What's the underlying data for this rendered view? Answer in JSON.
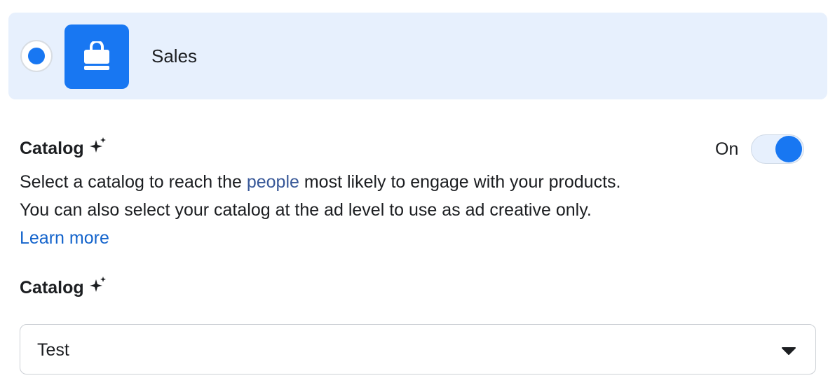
{
  "objective": {
    "label": "Sales",
    "selected": true,
    "icon": "shopping-bag-icon",
    "accent_color": "#1877f2",
    "card_background": "#e7f0fd"
  },
  "catalog_section": {
    "title": "Catalog",
    "title_icon": "sparkle-icon",
    "toggle": {
      "label": "On",
      "state": "on"
    },
    "description": {
      "part1": "Select a catalog to reach the ",
      "link": "people",
      "part2": " most likely to engage with your products.",
      "line2": "You can also select your catalog at the ad level to use as ad creative only."
    },
    "learn_more": "Learn more"
  },
  "catalog_field": {
    "label": "Catalog",
    "label_icon": "sparkle-icon",
    "selected_value": "Test",
    "caret_icon": "caret-down-icon"
  }
}
